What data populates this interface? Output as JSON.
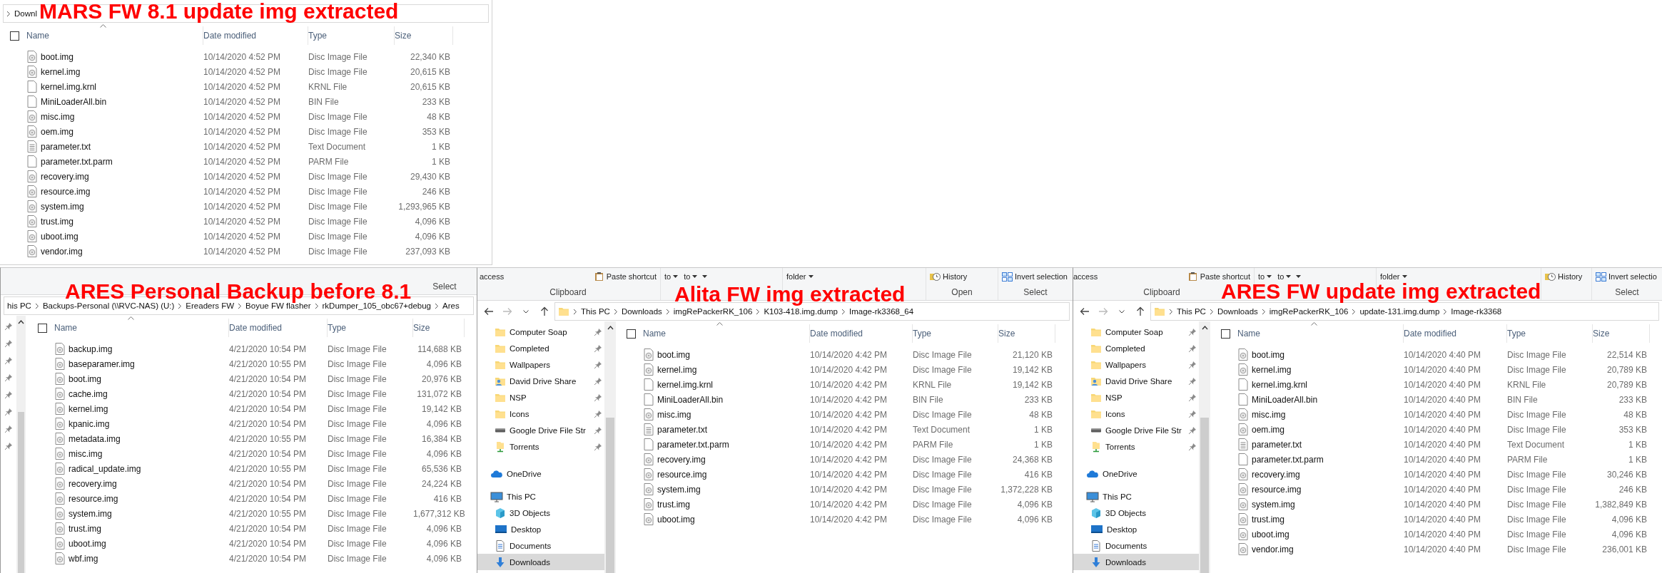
{
  "panels": [
    {
      "caption": "MARS FW 8.1 update img extracted",
      "history_buttons": false,
      "root_chevron": true,
      "breadcrumb": [
        "Downl"
      ],
      "select_all_checked": false,
      "columns": [
        "Name",
        "Date modified",
        "Type",
        "Size"
      ],
      "files": [
        {
          "name": "boot.img",
          "date": "10/14/2020 4:52 PM",
          "type": "Disc Image File",
          "size": "22,340 KB",
          "kind": "disc"
        },
        {
          "name": "kernel.img",
          "date": "10/14/2020 4:52 PM",
          "type": "Disc Image File",
          "size": "20,615 KB",
          "kind": "disc"
        },
        {
          "name": "kernel.img.krnl",
          "date": "10/14/2020 4:52 PM",
          "type": "KRNL File",
          "size": "20,615 KB",
          "kind": "blank"
        },
        {
          "name": "MiniLoaderAll.bin",
          "date": "10/14/2020 4:52 PM",
          "type": "BIN File",
          "size": "233 KB",
          "kind": "blank"
        },
        {
          "name": "misc.img",
          "date": "10/14/2020 4:52 PM",
          "type": "Disc Image File",
          "size": "48 KB",
          "kind": "disc"
        },
        {
          "name": "oem.img",
          "date": "10/14/2020 4:52 PM",
          "type": "Disc Image File",
          "size": "353 KB",
          "kind": "disc"
        },
        {
          "name": "parameter.txt",
          "date": "10/14/2020 4:52 PM",
          "type": "Text Document",
          "size": "1 KB",
          "kind": "text"
        },
        {
          "name": "parameter.txt.parm",
          "date": "10/14/2020 4:52 PM",
          "type": "PARM File",
          "size": "1 KB",
          "kind": "blank"
        },
        {
          "name": "recovery.img",
          "date": "10/14/2020 4:52 PM",
          "type": "Disc Image File",
          "size": "29,430 KB",
          "kind": "disc"
        },
        {
          "name": "resource.img",
          "date": "10/14/2020 4:52 PM",
          "type": "Disc Image File",
          "size": "246 KB",
          "kind": "disc"
        },
        {
          "name": "system.img",
          "date": "10/14/2020 4:52 PM",
          "type": "Disc Image File",
          "size": "1,293,965 KB",
          "kind": "disc"
        },
        {
          "name": "trust.img",
          "date": "10/14/2020 4:52 PM",
          "type": "Disc Image File",
          "size": "4,096 KB",
          "kind": "disc"
        },
        {
          "name": "uboot.img",
          "date": "10/14/2020 4:52 PM",
          "type": "Disc Image File",
          "size": "4,096 KB",
          "kind": "disc"
        },
        {
          "name": "vendor.img",
          "date": "10/14/2020 4:52 PM",
          "type": "Disc Image File",
          "size": "237,093 KB",
          "kind": "disc"
        }
      ]
    },
    {
      "caption": "ARES Personal Backup before 8.1",
      "ribbon": [
        {
          "kind": "select",
          "label": "Select"
        }
      ],
      "history_buttons": false,
      "root_chevron": false,
      "breadcrumb": [
        "his PC",
        "Backups-Personal (\\\\RVC-NAS) (U:)",
        "Ereaders FW",
        "Boyue FW flasher",
        "rkDumper_105_obc67+debug",
        "Ares"
      ],
      "nav": [
        {
          "pinned": true
        },
        {
          "pinned": true
        },
        {
          "pinned": true
        },
        {
          "pinned": true
        },
        {
          "pinned": true
        },
        {
          "pinned": true
        },
        {
          "pinned": true
        },
        {
          "pinned": true
        }
      ],
      "select_all_checked": false,
      "columns": [
        "Name",
        "Date modified",
        "Type",
        "Size"
      ],
      "files": [
        {
          "name": "backup.img",
          "date": "4/21/2020 10:54 PM",
          "type": "Disc Image File",
          "size": "114,688 KB",
          "kind": "disc"
        },
        {
          "name": "baseparamer.img",
          "date": "4/21/2020 10:55 PM",
          "type": "Disc Image File",
          "size": "4,096 KB",
          "kind": "disc"
        },
        {
          "name": "boot.img",
          "date": "4/21/2020 10:54 PM",
          "type": "Disc Image File",
          "size": "20,976 KB",
          "kind": "disc"
        },
        {
          "name": "cache.img",
          "date": "4/21/2020 10:54 PM",
          "type": "Disc Image File",
          "size": "131,072 KB",
          "kind": "disc"
        },
        {
          "name": "kernel.img",
          "date": "4/21/2020 10:54 PM",
          "type": "Disc Image File",
          "size": "19,142 KB",
          "kind": "disc"
        },
        {
          "name": "kpanic.img",
          "date": "4/21/2020 10:54 PM",
          "type": "Disc Image File",
          "size": "4,096 KB",
          "kind": "disc"
        },
        {
          "name": "metadata.img",
          "date": "4/21/2020 10:55 PM",
          "type": "Disc Image File",
          "size": "16,384 KB",
          "kind": "disc"
        },
        {
          "name": "misc.img",
          "date": "4/21/2020 10:54 PM",
          "type": "Disc Image File",
          "size": "4,096 KB",
          "kind": "disc"
        },
        {
          "name": "radical_update.img",
          "date": "4/21/2020 10:55 PM",
          "type": "Disc Image File",
          "size": "65,536 KB",
          "kind": "disc"
        },
        {
          "name": "recovery.img",
          "date": "4/21/2020 10:54 PM",
          "type": "Disc Image File",
          "size": "24,224 KB",
          "kind": "disc"
        },
        {
          "name": "resource.img",
          "date": "4/21/2020 10:54 PM",
          "type": "Disc Image File",
          "size": "416 KB",
          "kind": "disc"
        },
        {
          "name": "system.img",
          "date": "4/21/2020 10:55 PM",
          "type": "Disc Image File",
          "size": "1,677,312 KB",
          "kind": "disc"
        },
        {
          "name": "trust.img",
          "date": "4/21/2020 10:54 PM",
          "type": "Disc Image File",
          "size": "4,096 KB",
          "kind": "disc"
        },
        {
          "name": "uboot.img",
          "date": "4/21/2020 10:54 PM",
          "type": "Disc Image File",
          "size": "4,096 KB",
          "kind": "disc"
        },
        {
          "name": "wbf.img",
          "date": "4/21/2020 10:54 PM",
          "type": "Disc Image File",
          "size": "4,096 KB",
          "kind": "disc"
        }
      ]
    },
    {
      "caption": "Alita FW img extracted",
      "ribbon": [
        {
          "kind": "clipboard",
          "label": "Clipboard",
          "items": [
            {
              "kind": "plain",
              "label": "access"
            },
            {
              "kind": "paste",
              "label": "Paste shortcut"
            }
          ]
        },
        {
          "kind": "organize",
          "items": [
            {
              "kind": "dropdown",
              "label": "to"
            },
            {
              "kind": "dropdown",
              "label": "to"
            },
            {
              "kind": "caret"
            }
          ]
        },
        {
          "kind": "new",
          "items": [
            {
              "kind": "dropdown",
              "label": "folder"
            }
          ]
        },
        {
          "kind": "open",
          "label": "Open",
          "items": [
            {
              "kind": "history",
              "label": "History"
            }
          ]
        },
        {
          "kind": "select",
          "label": "Select",
          "items": [
            {
              "kind": "invert",
              "label": "Invert selection"
            }
          ]
        }
      ],
      "history_buttons": true,
      "root_chevron": true,
      "breadcrumb": [
        "This PC",
        "Downloads",
        "imgRePackerRK_106",
        "K103-418.img.dump",
        "Image-rk3368_64"
      ],
      "nav": [
        {
          "label": "Computer Soap",
          "kind": "folder",
          "pinned": true,
          "selected": false
        },
        {
          "label": "Completed",
          "kind": "folder",
          "pinned": true,
          "selected": false
        },
        {
          "label": "Wallpapers",
          "kind": "folder",
          "pinned": true,
          "selected": false
        },
        {
          "label": "David Drive Share",
          "kind": "shared",
          "pinned": true,
          "selected": false
        },
        {
          "label": "NSP",
          "kind": "folder",
          "pinned": true,
          "selected": false
        },
        {
          "label": "Icons",
          "kind": "folder",
          "pinned": true,
          "selected": false
        },
        {
          "label": "Google Drive File Str",
          "kind": "drive",
          "pinned": true,
          "selected": false
        },
        {
          "label": "Torrents",
          "kind": "network",
          "pinned": true,
          "selected": false
        },
        {
          "label": "OneDrive",
          "kind": "cloud",
          "pinned": false,
          "selected": false
        },
        {
          "label": "This PC",
          "kind": "pc",
          "pinned": false,
          "selected": false,
          "children": [
            {
              "label": "3D Objects",
              "kind": "cube",
              "pinned": false,
              "selected": false
            },
            {
              "label": "Desktop",
              "kind": "desktop",
              "pinned": false,
              "selected": false
            },
            {
              "label": "Documents",
              "kind": "documents",
              "pinned": false,
              "selected": false
            },
            {
              "label": "Downloads",
              "kind": "downloads",
              "pinned": false,
              "selected": true
            }
          ]
        }
      ],
      "select_all_checked": false,
      "columns": [
        "Name",
        "Date modified",
        "Type",
        "Size"
      ],
      "files": [
        {
          "name": "boot.img",
          "date": "10/14/2020 4:42 PM",
          "type": "Disc Image File",
          "size": "21,120 KB",
          "kind": "disc"
        },
        {
          "name": "kernel.img",
          "date": "10/14/2020 4:42 PM",
          "type": "Disc Image File",
          "size": "19,142 KB",
          "kind": "disc"
        },
        {
          "name": "kernel.img.krnl",
          "date": "10/14/2020 4:42 PM",
          "type": "KRNL File",
          "size": "19,142 KB",
          "kind": "blank"
        },
        {
          "name": "MiniLoaderAll.bin",
          "date": "10/14/2020 4:42 PM",
          "type": "BIN File",
          "size": "233 KB",
          "kind": "blank"
        },
        {
          "name": "misc.img",
          "date": "10/14/2020 4:42 PM",
          "type": "Disc Image File",
          "size": "48 KB",
          "kind": "disc"
        },
        {
          "name": "parameter.txt",
          "date": "10/14/2020 4:42 PM",
          "type": "Text Document",
          "size": "1 KB",
          "kind": "text"
        },
        {
          "name": "parameter.txt.parm",
          "date": "10/14/2020 4:42 PM",
          "type": "PARM File",
          "size": "1 KB",
          "kind": "blank"
        },
        {
          "name": "recovery.img",
          "date": "10/14/2020 4:42 PM",
          "type": "Disc Image File",
          "size": "24,368 KB",
          "kind": "disc"
        },
        {
          "name": "resource.img",
          "date": "10/14/2020 4:42 PM",
          "type": "Disc Image File",
          "size": "416 KB",
          "kind": "disc"
        },
        {
          "name": "system.img",
          "date": "10/14/2020 4:42 PM",
          "type": "Disc Image File",
          "size": "1,372,228 KB",
          "kind": "disc"
        },
        {
          "name": "trust.img",
          "date": "10/14/2020 4:42 PM",
          "type": "Disc Image File",
          "size": "4,096 KB",
          "kind": "disc"
        },
        {
          "name": "uboot.img",
          "date": "10/14/2020 4:42 PM",
          "type": "Disc Image File",
          "size": "4,096 KB",
          "kind": "disc"
        }
      ]
    },
    {
      "caption": "ARES FW update img extracted",
      "ribbon": [
        {
          "kind": "clipboard",
          "label": "Clipboard",
          "items": [
            {
              "kind": "plain",
              "label": "access"
            },
            {
              "kind": "paste",
              "label": "Paste shortcut"
            }
          ]
        },
        {
          "kind": "organize",
          "items": [
            {
              "kind": "dropdown",
              "label": "to"
            },
            {
              "kind": "dropdown",
              "label": "to"
            },
            {
              "kind": "caret"
            }
          ]
        },
        {
          "kind": "new",
          "items": [
            {
              "kind": "dropdown",
              "label": "folder"
            }
          ]
        },
        {
          "kind": "open",
          "items": [
            {
              "kind": "history",
              "label": "History"
            }
          ]
        },
        {
          "kind": "select",
          "label": "Select",
          "items": [
            {
              "kind": "invert",
              "label": "Invert selectio"
            }
          ]
        }
      ],
      "history_buttons": true,
      "root_chevron": true,
      "breadcrumb": [
        "This PC",
        "Downloads",
        "imgRePackerRK_106",
        "update-131.img.dump",
        "Image-rk3368"
      ],
      "nav": [
        {
          "label": "Computer Soap",
          "kind": "folder",
          "pinned": true,
          "selected": false
        },
        {
          "label": "Completed",
          "kind": "folder",
          "pinned": true,
          "selected": false
        },
        {
          "label": "Wallpapers",
          "kind": "folder",
          "pinned": true,
          "selected": false
        },
        {
          "label": "David Drive Share",
          "kind": "shared",
          "pinned": true,
          "selected": false
        },
        {
          "label": "NSP",
          "kind": "folder",
          "pinned": true,
          "selected": false
        },
        {
          "label": "Icons",
          "kind": "folder",
          "pinned": true,
          "selected": false
        },
        {
          "label": "Google Drive File Str",
          "kind": "drive",
          "pinned": true,
          "selected": false
        },
        {
          "label": "Torrents",
          "kind": "network",
          "pinned": true,
          "selected": false
        },
        {
          "label": "OneDrive",
          "kind": "cloud",
          "pinned": false,
          "selected": false
        },
        {
          "label": "This PC",
          "kind": "pc",
          "pinned": false,
          "selected": false,
          "children": [
            {
              "label": "3D Objects",
              "kind": "cube",
              "pinned": false,
              "selected": false
            },
            {
              "label": "Desktop",
              "kind": "desktop",
              "pinned": false,
              "selected": false
            },
            {
              "label": "Documents",
              "kind": "documents",
              "pinned": false,
              "selected": false
            },
            {
              "label": "Downloads",
              "kind": "downloads",
              "pinned": false,
              "selected": true
            }
          ]
        }
      ],
      "select_all_checked": false,
      "columns": [
        "Name",
        "Date modified",
        "Type",
        "Size"
      ],
      "files": [
        {
          "name": "boot.img",
          "date": "10/14/2020 4:40 PM",
          "type": "Disc Image File",
          "size": "22,514 KB",
          "kind": "disc"
        },
        {
          "name": "kernel.img",
          "date": "10/14/2020 4:40 PM",
          "type": "Disc Image File",
          "size": "20,789 KB",
          "kind": "disc"
        },
        {
          "name": "kernel.img.krnl",
          "date": "10/14/2020 4:40 PM",
          "type": "KRNL File",
          "size": "20,789 KB",
          "kind": "blank"
        },
        {
          "name": "MiniLoaderAll.bin",
          "date": "10/14/2020 4:40 PM",
          "type": "BIN File",
          "size": "233 KB",
          "kind": "blank"
        },
        {
          "name": "misc.img",
          "date": "10/14/2020 4:40 PM",
          "type": "Disc Image File",
          "size": "48 KB",
          "kind": "disc"
        },
        {
          "name": "oem.img",
          "date": "10/14/2020 4:40 PM",
          "type": "Disc Image File",
          "size": "353 KB",
          "kind": "disc"
        },
        {
          "name": "parameter.txt",
          "date": "10/14/2020 4:40 PM",
          "type": "Text Document",
          "size": "1 KB",
          "kind": "text"
        },
        {
          "name": "parameter.txt.parm",
          "date": "10/14/2020 4:40 PM",
          "type": "PARM File",
          "size": "1 KB",
          "kind": "blank"
        },
        {
          "name": "recovery.img",
          "date": "10/14/2020 4:40 PM",
          "type": "Disc Image File",
          "size": "30,246 KB",
          "kind": "disc"
        },
        {
          "name": "resource.img",
          "date": "10/14/2020 4:40 PM",
          "type": "Disc Image File",
          "size": "246 KB",
          "kind": "disc"
        },
        {
          "name": "system.img",
          "date": "10/14/2020 4:40 PM",
          "type": "Disc Image File",
          "size": "1,382,849 KB",
          "kind": "disc"
        },
        {
          "name": "trust.img",
          "date": "10/14/2020 4:40 PM",
          "type": "Disc Image File",
          "size": "4,096 KB",
          "kind": "disc"
        },
        {
          "name": "uboot.img",
          "date": "10/14/2020 4:40 PM",
          "type": "Disc Image File",
          "size": "4,096 KB",
          "kind": "disc"
        },
        {
          "name": "vendor.img",
          "date": "10/14/2020 4:40 PM",
          "type": "Disc Image File",
          "size": "236,001 KB",
          "kind": "disc"
        }
      ]
    }
  ]
}
